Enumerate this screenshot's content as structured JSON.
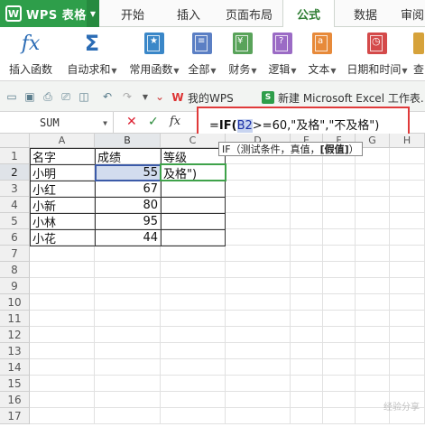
{
  "app": {
    "name": "WPS 表格",
    "logo": "W"
  },
  "menu_tabs": [
    {
      "label": "开始"
    },
    {
      "label": "插入"
    },
    {
      "label": "页面布局"
    },
    {
      "label": "公式",
      "active": true
    },
    {
      "label": "数据"
    },
    {
      "label": "审阅"
    }
  ],
  "ribbon": [
    {
      "label": "插入函数",
      "icon": "fx-icon",
      "dropdown": false
    },
    {
      "label": "自动求和",
      "icon": "sigma-icon",
      "dropdown": true
    },
    {
      "label": "常用函数",
      "icon": "star-book-icon",
      "dropdown": true
    },
    {
      "label": "全部",
      "icon": "list-book-icon",
      "dropdown": true
    },
    {
      "label": "财务",
      "icon": "finance-book-icon",
      "dropdown": true
    },
    {
      "label": "逻辑",
      "icon": "question-book-icon",
      "dropdown": true
    },
    {
      "label": "文本",
      "icon": "text-book-icon",
      "dropdown": true
    },
    {
      "label": "日期和时间",
      "icon": "clock-book-icon",
      "dropdown": true
    },
    {
      "label": "查",
      "icon": "lookup-icon",
      "dropdown": false
    }
  ],
  "doc_tabs": [
    {
      "label": "我的WPS",
      "icon": "wps-logo-icon"
    },
    {
      "label": "新建 Microsoft Excel 工作表.",
      "icon": "excel-file-icon"
    }
  ],
  "formula_bar": {
    "name_box": "SUM",
    "cancel_glyph": "✕",
    "enter_glyph": "✓",
    "fx_label": "fx",
    "formula_prefix": "=",
    "formula_fn": "IF",
    "formula_open": "(",
    "formula_ref": "B2",
    "formula_rest": ">=60,\"及格\",\"不及格\")"
  },
  "tooltip": {
    "prefix": "IF（测试条件，真值，",
    "bold": "[假值]",
    "suffix": "）"
  },
  "columns": [
    "A",
    "B",
    "C",
    "D",
    "E",
    "F",
    "G",
    "H"
  ],
  "rows": [
    "1",
    "2",
    "3",
    "4",
    "5",
    "6",
    "7",
    "8",
    "9",
    "10",
    "11",
    "12",
    "13",
    "14",
    "15",
    "16",
    "17"
  ],
  "table": {
    "headers": [
      "名字",
      "成绩",
      "等级"
    ],
    "rows": [
      {
        "name": "小明",
        "score": "55",
        "grade": "及格\")"
      },
      {
        "name": "小红",
        "score": "67",
        "grade": ""
      },
      {
        "name": "小新",
        "score": "80",
        "grade": ""
      },
      {
        "name": "小林",
        "score": "95",
        "grade": ""
      },
      {
        "name": "小花",
        "score": "44",
        "grade": ""
      }
    ]
  },
  "colors": {
    "brand": "#2e9e4a",
    "highlight_border": "#e03a3a",
    "selection": "#3b5aa8",
    "edit_border": "#3fa24a"
  },
  "watermark": "经验分享"
}
